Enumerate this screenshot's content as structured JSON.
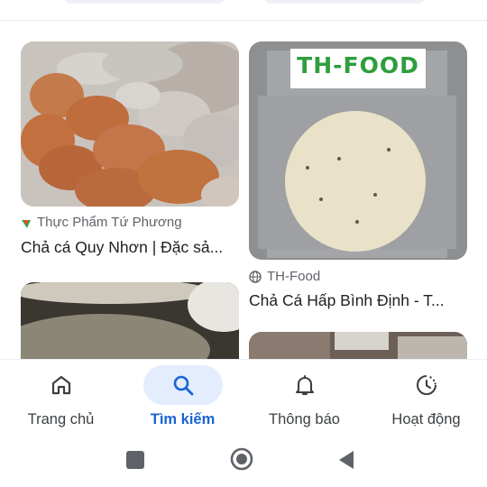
{
  "results": [
    {
      "source": "Thực Phẩm Tứ Phương",
      "source_icon": "tu-phuong-logo-icon",
      "title": "Chả cá Quy Nhơn | Đặc sả..."
    },
    {
      "source": "TH-Food",
      "source_icon": "globe-icon",
      "title": "Chả Cá Hấp Bình Định - T...",
      "image_logo_text": "TH-FOOD"
    }
  ],
  "nav": {
    "items": [
      {
        "label": "Trang chủ",
        "icon": "home-icon"
      },
      {
        "label": "Tìm kiếm",
        "icon": "search-icon",
        "active": true
      },
      {
        "label": "Thông báo",
        "icon": "bell-icon"
      },
      {
        "label": "Hoạt động",
        "icon": "history-icon"
      }
    ]
  },
  "colors": {
    "accent": "#1a63d6",
    "active_pill": "#e3edfd",
    "text_secondary": "#5f6368"
  }
}
